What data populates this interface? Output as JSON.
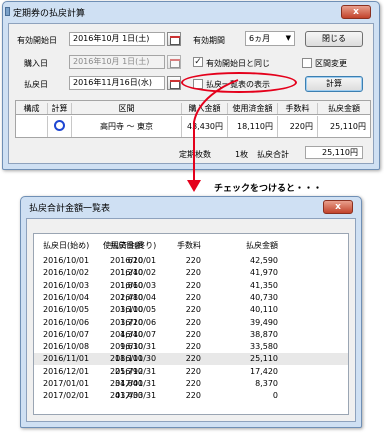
{
  "dialog": {
    "title": "定期券の払戻計算",
    "close_glyph": "x",
    "start_date_label": "有効開始日",
    "start_date_value": "2016年10月 1日(土)",
    "period_label": "有効期間",
    "period_value": "6ヵ月",
    "close_button": "閉じる",
    "purchase_label": "購入日",
    "purchase_value": "2016年10月 1日(土)",
    "same_as_start_label": "有効開始日と同じ",
    "same_as_start_checked": true,
    "refund_label": "払戻日",
    "refund_value": "2016年11月16日(水)",
    "show_list_label": "払戻一覧表の表示",
    "show_list_checked": false,
    "section_change_label": "区間変更",
    "section_change_checked": false,
    "calc_button": "計算",
    "table": {
      "headers": [
        "構成",
        "計算",
        "区間",
        "購入金額",
        "使用済金額",
        "手数料",
        "払戻金額"
      ],
      "row": {
        "kosei": "",
        "section": "高円寺 ～ 東京",
        "purchase": "43,430円",
        "used": "18,110円",
        "fee": "220円",
        "refund": "25,110円"
      }
    },
    "ticket_count_label": "定期枚数",
    "ticket_count_value": "1枚",
    "refund_total_label": "払戻合計",
    "refund_total_value": "25,110円"
  },
  "annotation": {
    "caption": "チェックをつけると・・・",
    "ring_color": "#e4001b"
  },
  "list_window": {
    "title": "払戻合計金額一覧表",
    "close_glyph": "x",
    "headers": [
      "払戻日(始め)",
      "払戻日(終り)",
      "使用済金額",
      "手数料",
      "払戻金額"
    ],
    "rows": [
      [
        "2016/10/01",
        "2016/10/01",
        "620",
        "220",
        "42,590"
      ],
      [
        "2016/10/02",
        "2016/10/02",
        "1,240",
        "220",
        "41,970"
      ],
      [
        "2016/10/03",
        "2016/10/03",
        "1,860",
        "220",
        "41,350"
      ],
      [
        "2016/10/04",
        "2016/10/04",
        "2,480",
        "220",
        "40,730"
      ],
      [
        "2016/10/05",
        "2016/10/05",
        "3,100",
        "220",
        "40,110"
      ],
      [
        "2016/10/06",
        "2016/10/06",
        "3,720",
        "220",
        "39,490"
      ],
      [
        "2016/10/07",
        "2016/10/07",
        "4,340",
        "220",
        "38,870"
      ],
      [
        "2016/10/08",
        "2016/10/31",
        "9,630",
        "220",
        "33,580"
      ],
      [
        "2016/11/01",
        "2016/11/30",
        "18,100",
        "220",
        "25,110"
      ],
      [
        "2016/12/01",
        "2016/12/31",
        "25,790",
        "220",
        "17,420"
      ],
      [
        "2017/01/01",
        "2017/01/31",
        "34,840",
        "220",
        "8,370"
      ],
      [
        "2017/02/01",
        "2017/03/31",
        "43,430",
        "220",
        "0"
      ]
    ],
    "highlighted_row": 8
  }
}
